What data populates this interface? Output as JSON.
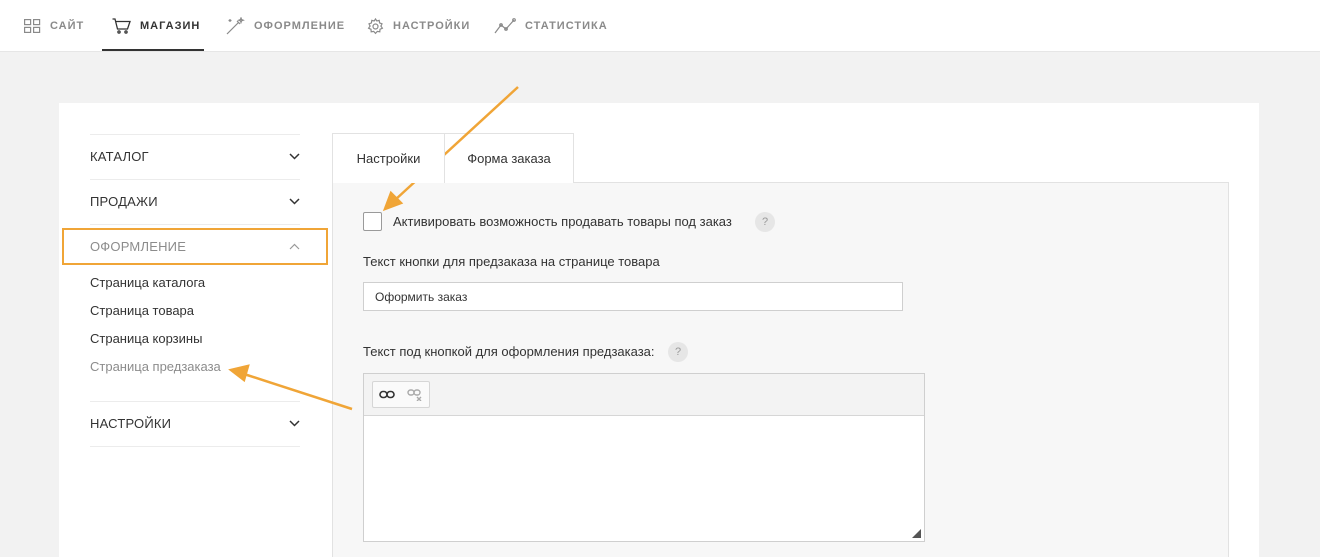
{
  "topnav": {
    "items": [
      {
        "label": "САЙТ",
        "icon": "grid-icon"
      },
      {
        "label": "МАГАЗИН",
        "icon": "cart-icon"
      },
      {
        "label": "ОФОРМЛЕНИЕ",
        "icon": "magic-wand-icon"
      },
      {
        "label": "НАСТРОЙКИ",
        "icon": "gear-icon"
      },
      {
        "label": "СТАТИСТИКА",
        "icon": "chart-line-icon"
      }
    ],
    "active_index": 1
  },
  "sidebar": {
    "sections": [
      {
        "label": "КАТАЛОГ",
        "expanded": false
      },
      {
        "label": "ПРОДАЖИ",
        "expanded": false
      },
      {
        "label": "ОФОРМЛЕНИЕ",
        "expanded": true
      },
      {
        "label": "НАСТРОЙКИ",
        "expanded": false
      }
    ],
    "subitems": [
      {
        "label": "Страница каталога"
      },
      {
        "label": "Страница товара"
      },
      {
        "label": "Страница корзины"
      },
      {
        "label": "Страница предзаказа",
        "active": true
      }
    ]
  },
  "tabs": [
    {
      "label": "Настройки",
      "active": true
    },
    {
      "label": "Форма заказа",
      "active": false
    }
  ],
  "form": {
    "preorder_checkbox_label": "Активировать возможность продавать товары под заказ",
    "preorder_checked": false,
    "help_mark": "?",
    "button_text_label": "Текст кнопки для предзаказа на странице товара",
    "button_text_value": "Оформить заказ",
    "under_button_label": "Текст под кнопкой для оформления предзаказа:",
    "editor_content": ""
  },
  "colors": {
    "annotation": "#f0a537",
    "background": "#f2f2f2"
  }
}
